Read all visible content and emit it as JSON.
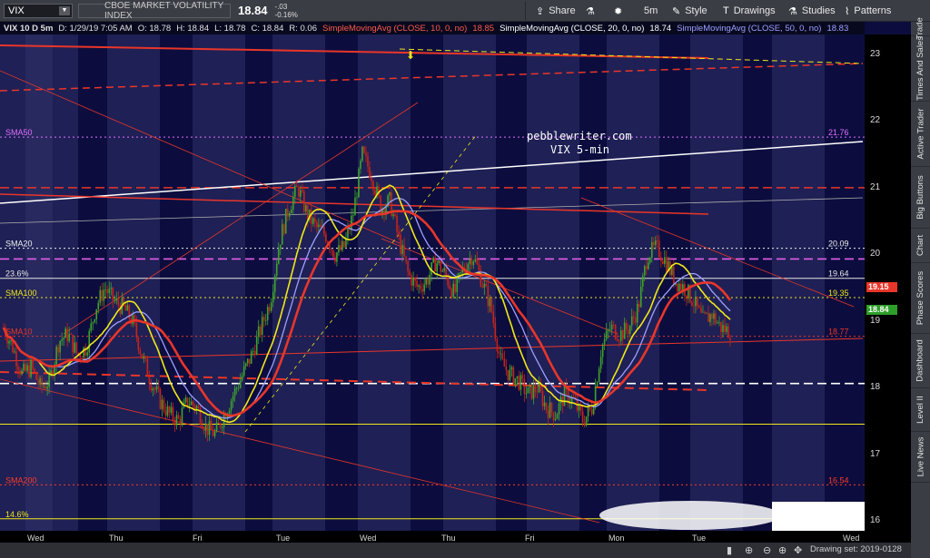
{
  "header": {
    "symbol": "VIX",
    "description": "CBOE MARKET VOLATILITY INDEX",
    "last": "18.84",
    "change": "-.03",
    "change_pct": "-0.16%",
    "buttons": {
      "share": "Share",
      "timeframe": "5m",
      "style": "Style",
      "drawings": "Drawings",
      "studies": "Studies",
      "patterns": "Patterns"
    }
  },
  "info_bar": {
    "instrument": "VIX 10 D 5m",
    "datetime": "D: 1/29/19 7:05 AM",
    "open": "O: 18.78",
    "high": "H: 18.84",
    "low": "L: 18.78",
    "close": "C: 18.84",
    "range": "R: 0.06",
    "sma10_label": "SimpleMovingAvg (CLOSE, 10, 0, no)",
    "sma10_value": "18.85",
    "sma20_label": "SimpleMovingAvg (CLOSE, 20, 0, no)",
    "sma20_value": "18.74",
    "sma50_label": "SimpleMovingAvg (CLOSE, 50, 0, no)",
    "sma50_value": "18.83"
  },
  "right_tabs": [
    "Trade",
    "Times And Sales",
    "Active Trader",
    "Big Buttons",
    "Chart",
    "Phase Scores",
    "Dashboard",
    "Level II",
    "Live News"
  ],
  "price_badges": {
    "sma10": "19.15",
    "last": "18.84"
  },
  "annotation": {
    "line1": "pebblewriter.com",
    "line2": "VIX 5-min"
  },
  "colors": {
    "background": "#0c0d3e",
    "stripe": "#303268",
    "sma10": "#e8362a",
    "sma20": "#f0e81a",
    "sma50": "#9da0ff",
    "candle_up": "#3fa32c",
    "candle_down": "#c92418"
  },
  "drawing_date": "Drawing set: 2019-0128",
  "chart_data": {
    "type": "candlestick",
    "title": "",
    "subtitle": "VIX 5-min",
    "xlabel": "",
    "ylabel": "",
    "ylim": [
      15.85,
      23.3
    ],
    "yticks": [
      16,
      17,
      18,
      19,
      20,
      21,
      22,
      23
    ],
    "x_day_labels": [
      "Wed",
      "Thu",
      "Fri",
      "Tue",
      "Wed",
      "Thu",
      "Fri",
      "Mon",
      "Tue",
      "Wed"
    ],
    "grid": false,
    "path_points": [
      [
        0,
        18.9
      ],
      [
        2,
        18.6
      ],
      [
        4,
        18.2
      ],
      [
        6,
        18.3
      ],
      [
        8,
        18.0
      ],
      [
        10,
        18.1
      ],
      [
        12,
        18.7
      ],
      [
        14,
        18.8
      ],
      [
        16,
        18.5
      ],
      [
        18,
        18.6
      ],
      [
        20,
        19.2
      ],
      [
        22,
        19.5
      ],
      [
        24,
        19.3
      ],
      [
        26,
        19.2
      ],
      [
        28,
        19.0
      ],
      [
        30,
        18.5
      ],
      [
        32,
        18.1
      ],
      [
        34,
        17.8
      ],
      [
        36,
        17.6
      ],
      [
        38,
        17.5
      ],
      [
        40,
        17.8
      ],
      [
        42,
        17.7
      ],
      [
        44,
        17.4
      ],
      [
        46,
        17.3
      ],
      [
        48,
        17.6
      ],
      [
        50,
        17.9
      ],
      [
        52,
        18.2
      ],
      [
        54,
        18.5
      ],
      [
        56,
        18.9
      ],
      [
        58,
        19.3
      ],
      [
        60,
        20.2
      ],
      [
        62,
        20.7
      ],
      [
        64,
        21.0
      ],
      [
        66,
        20.6
      ],
      [
        68,
        20.4
      ],
      [
        70,
        20.3
      ],
      [
        72,
        20.0
      ],
      [
        74,
        20.1
      ],
      [
        76,
        20.6
      ],
      [
        78,
        21.5
      ],
      [
        80,
        21.2
      ],
      [
        82,
        20.7
      ],
      [
        84,
        20.8
      ],
      [
        86,
        20.2
      ],
      [
        88,
        19.7
      ],
      [
        90,
        19.5
      ],
      [
        92,
        19.6
      ],
      [
        94,
        19.9
      ],
      [
        96,
        19.7
      ],
      [
        98,
        19.4
      ],
      [
        100,
        19.8
      ],
      [
        102,
        20.0
      ],
      [
        104,
        19.6
      ],
      [
        106,
        19.2
      ],
      [
        108,
        18.4
      ],
      [
        110,
        18.2
      ],
      [
        112,
        18.1
      ],
      [
        114,
        17.9
      ],
      [
        116,
        18.0
      ],
      [
        118,
        17.7
      ],
      [
        120,
        17.6
      ],
      [
        122,
        17.9
      ],
      [
        124,
        17.8
      ],
      [
        126,
        17.5
      ],
      [
        128,
        17.7
      ],
      [
        130,
        18.6
      ],
      [
        132,
        18.9
      ],
      [
        134,
        18.8
      ],
      [
        136,
        18.9
      ],
      [
        138,
        19.2
      ],
      [
        140,
        20.0
      ],
      [
        142,
        20.1
      ],
      [
        144,
        19.9
      ],
      [
        146,
        19.6
      ],
      [
        148,
        19.5
      ],
      [
        150,
        19.3
      ],
      [
        152,
        19.0
      ],
      [
        154,
        19.1
      ],
      [
        156,
        18.9
      ],
      [
        158,
        18.84
      ]
    ],
    "smas": {
      "sma10_periods": 10,
      "sma20_periods": 20,
      "sma50_periods": 50
    },
    "horizontal_levels": [
      {
        "label": "SMA50",
        "value": 21.76,
        "color": "#e070ff",
        "style": "dotted"
      },
      {
        "label": "",
        "value": 21.0,
        "color": "#e8362a",
        "style": "dashed"
      },
      {
        "label": "SMA20",
        "value": 20.09,
        "color": "#f0f0f0",
        "style": "dotted"
      },
      {
        "label": "",
        "value": 19.93,
        "color": "#e060e8",
        "style": "dashed"
      },
      {
        "label": "23.6%",
        "value": 19.64,
        "color": "#e8e8e8",
        "style": "solid"
      },
      {
        "label": "SMA100",
        "value": 19.35,
        "color": "#f0e81a",
        "style": "dotted"
      },
      {
        "label": "SMA10",
        "value": 18.77,
        "color": "#e8362a",
        "style": "dotted"
      },
      {
        "label": "",
        "value": 18.06,
        "color": "#ffffff",
        "style": "dashed"
      },
      {
        "label": "",
        "value": 17.45,
        "color": "#f0e81a",
        "style": "solid"
      },
      {
        "label": "SMA200",
        "value": 16.54,
        "color": "#ff3a2a",
        "style": "dotted"
      },
      {
        "label": "14.6%",
        "value": 16.03,
        "color": "#f0e81a",
        "style": "solid"
      }
    ]
  }
}
